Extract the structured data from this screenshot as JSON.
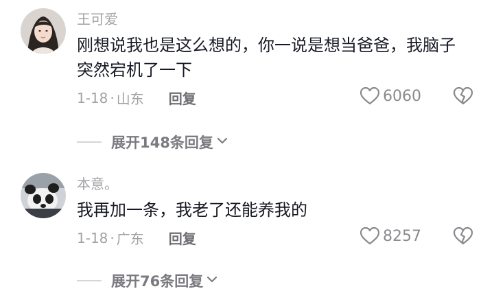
{
  "comments": [
    {
      "username": "王可爱",
      "text": "刚想说我也是这么想的，你一说是想当爸爸，我脑子突然宕机了一下",
      "date": "1-18",
      "location": "山东",
      "reply_label": "回复",
      "likes": "6060",
      "avatar": "woman-portrait",
      "expand_label": "展开148条回复"
    },
    {
      "username": "本意。",
      "text": "我再加一条，我老了还能养我的",
      "date": "1-18",
      "location": "广东",
      "reply_label": "回复",
      "likes": "8257",
      "avatar": "panda-photo",
      "expand_label": "展开76条回复"
    }
  ],
  "separator": "·"
}
